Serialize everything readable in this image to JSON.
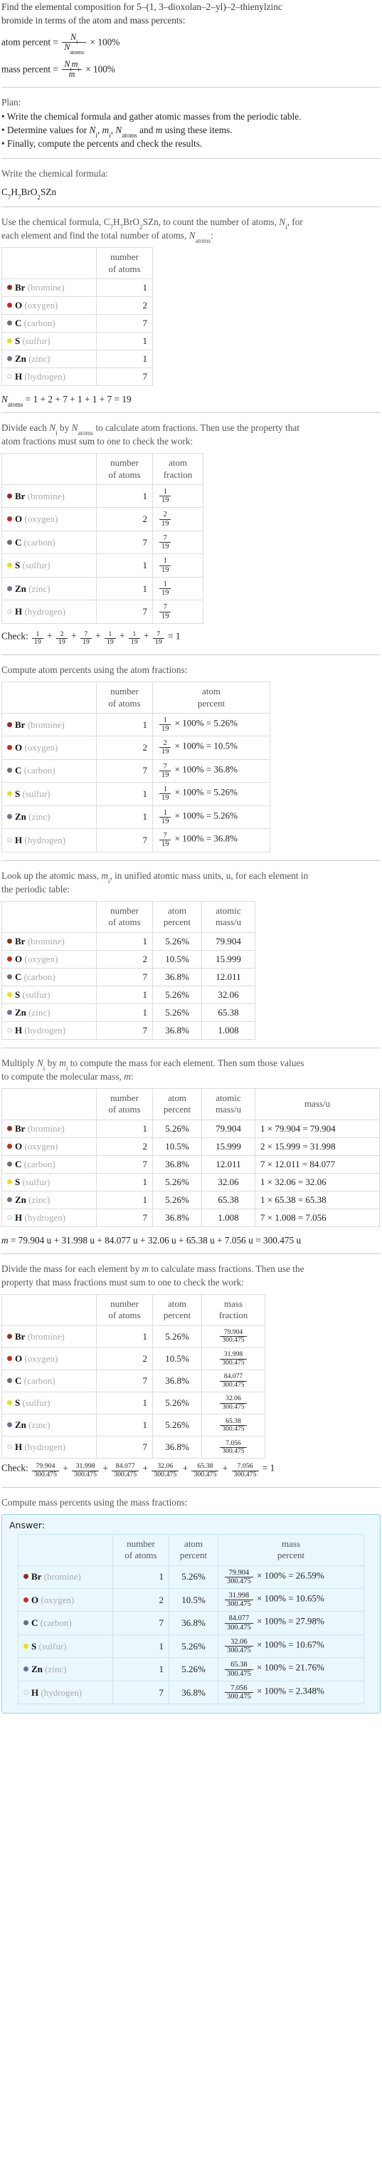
{
  "problem": {
    "line1": "Find the elemental composition for 5–(1, 3–dioxolan–2–yl)–2–thienylzinc",
    "line2": "bromide in terms of the atom and mass percents:",
    "atom_percent_label": "atom percent = ",
    "atom_percent_num": "N",
    "atom_percent_num_sub": "i",
    "atom_percent_den": "N",
    "atom_percent_den_sub": "atoms",
    "atom_percent_tail": "× 100%",
    "mass_percent_label": "mass percent = ",
    "mass_percent_num": "N",
    "mass_percent_num_sub": "i",
    "mass_percent_num2": "m",
    "mass_percent_num2_sub": "i",
    "mass_percent_den": "m",
    "mass_percent_tail": "× 100%"
  },
  "plan": {
    "heading": "Plan:",
    "bullets": [
      "• Write the chemical formula and gather atomic masses from the periodic table.",
      "• Determine values for Nᵢ, mᵢ, Nₐₜₒₘₛ and m using these items.",
      "• Finally, compute the percents and check the results."
    ]
  },
  "formula_section": {
    "heading": "Write the chemical formula:",
    "formula": "C7H7BrO2SZn"
  },
  "count_section": {
    "line1": "Use the chemical formula, C",
    "line1b": "H",
    "line1c": "BrO",
    "line1d": "SZn, to count the number of atoms, ",
    "line1e": ", for",
    "line2": "each element and find the total number of atoms, ",
    "line2b": ".",
    "headers": [
      "",
      "number\nof atoms"
    ],
    "header_num_atoms_l1": "number",
    "header_num_atoms_l2": "of atoms",
    "total_text": "= 1 + 2 + 7 + 1 + 1 + 7 = 19",
    "total_label": "N",
    "total_label_sub": "atoms"
  },
  "elements": [
    {
      "symbol": "Br",
      "name": "(bromine)",
      "color": "#8c2f20",
      "ring": false,
      "count": "1",
      "fraction_num": "1",
      "fraction_den": "19",
      "atom_percent": "5.26%",
      "atomic_mass": "79.904",
      "mass_expr": "1 × 79.904 = 79.904",
      "mass_value": "79.904",
      "mass_percent": "26.59%"
    },
    {
      "symbol": "O",
      "name": "(oxygen)",
      "color": "#c32b20",
      "ring": false,
      "count": "2",
      "fraction_num": "2",
      "fraction_den": "19",
      "atom_percent": "10.5%",
      "atomic_mass": "15.999",
      "mass_expr": "2 × 15.999 = 31.998",
      "mass_value": "31.998",
      "mass_percent": "10.65%"
    },
    {
      "symbol": "C",
      "name": "(carbon)",
      "color": "#6e6e6e",
      "ring": false,
      "count": "7",
      "fraction_num": "7",
      "fraction_den": "19",
      "atom_percent": "36.8%",
      "atomic_mass": "12.011",
      "mass_expr": "7 × 12.011 = 84.077",
      "mass_value": "84.077",
      "mass_percent": "27.98%"
    },
    {
      "symbol": "S",
      "name": "(sulfur)",
      "color": "#e8e212",
      "ring": false,
      "count": "1",
      "fraction_num": "1",
      "fraction_den": "19",
      "atom_percent": "5.26%",
      "atomic_mass": "32.06",
      "mass_expr": "1 × 32.06 = 32.06",
      "mass_value": "32.06",
      "mass_percent": "10.67%"
    },
    {
      "symbol": "Zn",
      "name": "(zinc)",
      "color": "#6e6e99",
      "ring": false,
      "count": "1",
      "fraction_num": "1",
      "fraction_den": "19",
      "atom_percent": "5.26%",
      "atomic_mass": "65.38",
      "mass_expr": "1 × 65.38 = 65.38",
      "mass_value": "65.38",
      "mass_percent": "21.76%"
    },
    {
      "symbol": "H",
      "name": "(hydrogen)",
      "color": "#eaf6fb",
      "ring": true,
      "count": "7",
      "fraction_num": "7",
      "fraction_den": "19",
      "atom_percent": "36.8%",
      "atomic_mass": "1.008",
      "mass_expr": "7 × 1.008 = 7.056",
      "mass_value": "7.056",
      "mass_percent": "2.348%"
    }
  ],
  "fraction_section": {
    "line1a": "Divide each ",
    "line1b": " by ",
    "line1c": " to calculate atom fractions. Then use the property that",
    "line2": "atom fractions must sum to one to check the work:",
    "header_atom_fraction_l1": "atom",
    "header_atom_fraction_l2": "fraction",
    "check_label": "Check:",
    "check_result": "= 1",
    "check_terms": [
      {
        "num": "1",
        "den": "19"
      },
      {
        "num": "2",
        "den": "19"
      },
      {
        "num": "7",
        "den": "19"
      },
      {
        "num": "1",
        "den": "19"
      },
      {
        "num": "1",
        "den": "19"
      },
      {
        "num": "7",
        "den": "19"
      }
    ]
  },
  "atom_percent_section": {
    "heading": "Compute atom percents using the atom fractions:",
    "header_atom_percent_l1": "atom",
    "header_atom_percent_l2": "percent",
    "times_100": "× 100% = "
  },
  "atomic_mass_section": {
    "line1a": "Look up the atomic mass, ",
    "line1b": ", in unified atomic mass units, u, for each element in",
    "line2": "the periodic table:",
    "header_atomic_mass_l1": "atomic",
    "header_atomic_mass_l2": "mass/u"
  },
  "multiply_section": {
    "line1a": "Multiply ",
    "line1b": " by ",
    "line1c": " to compute the mass for each element. Then sum those values",
    "line2a": "to compute the molecular mass, ",
    "line2b": ":",
    "header_mass_u": "mass/u",
    "sum_text": "= 79.904 u + 31.998 u + 84.077 u + 32.06 u + 65.38 u + 7.056 u = 300.475 u",
    "sum_label": "m"
  },
  "mass_fraction_section": {
    "line1a": "Divide the mass for each element by ",
    "line1b": " to calculate mass fractions. Then use the",
    "line2": "property that mass fractions must sum to one to check the work:",
    "header_mass_fraction_l1": "mass",
    "header_mass_fraction_l2": "fraction",
    "denominator": "300.475",
    "check_label": "Check:",
    "check_result": "= 1"
  },
  "mass_percent_section": {
    "heading": "Compute mass percents using the mass fractions:",
    "answer_label": "Answer:",
    "header_mass_percent_l1": "mass",
    "header_mass_percent_l2": "percent",
    "denominator": "300.475",
    "times_100": "× 100% = "
  },
  "common": {
    "header_blank": "",
    "header_number_l1": "number",
    "header_number_l2": "of atoms"
  }
}
